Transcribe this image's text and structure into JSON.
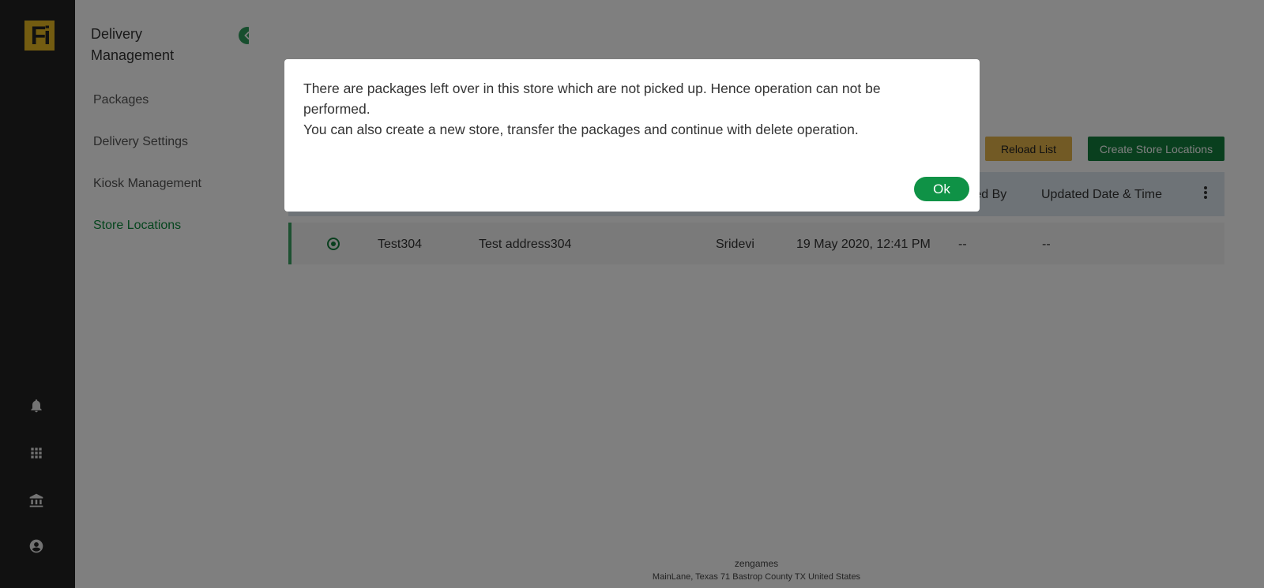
{
  "rail": {
    "logo_text": "Fi",
    "icons": [
      "bell-icon",
      "apps-grid-icon",
      "bank-icon",
      "account-circle-icon"
    ]
  },
  "subnav": {
    "title": "Delivery Management",
    "items": [
      {
        "label": "Packages",
        "active": false
      },
      {
        "label": "Delivery Settings",
        "active": false
      },
      {
        "label": "Kiosk Management",
        "active": false
      },
      {
        "label": "Store Locations",
        "active": true
      }
    ]
  },
  "toolbar": {
    "reload_label": "Reload List",
    "create_label": "Create Store Locations"
  },
  "table": {
    "visible_headers": [
      "ated By",
      "Updated Date & Time"
    ],
    "rows": [
      {
        "selected": true,
        "name": "Test304",
        "address": "Test address304",
        "created_by": "Sridevi",
        "created_at": "19 May 2020, 12:41 PM",
        "updated_by": "--",
        "updated_at": "--"
      }
    ]
  },
  "footer": {
    "company": "zengames",
    "address": "MainLane, Texas 71 Bastrop County TX United States"
  },
  "modal": {
    "line1": "There are packages left over in this store which are not picked up. Hence operation can not be performed.",
    "line2": "You can also create a new store, transfer the packages and continue with delete operation.",
    "ok_label": "Ok"
  },
  "colors": {
    "rail_bg": "#222222",
    "logo_bg": "#e6b923",
    "accent_green": "#137f3d",
    "reload_yellow": "#e5b44a",
    "overlay": "rgba(0,0,0,0.5)"
  }
}
